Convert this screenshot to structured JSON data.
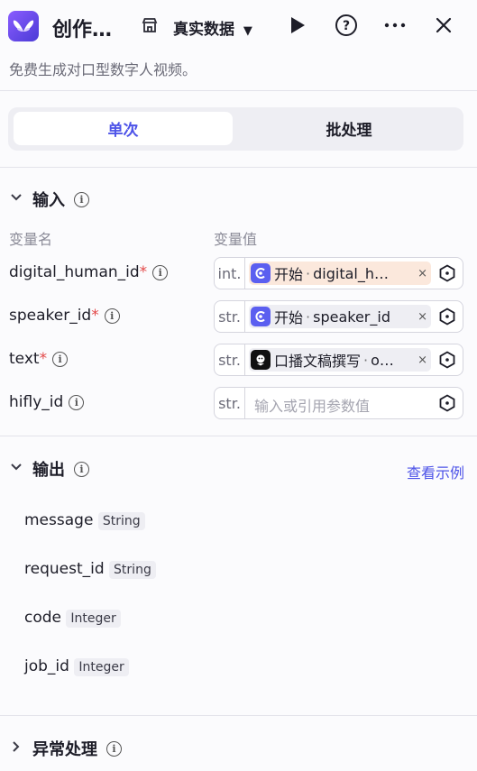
{
  "header": {
    "title": "创作…",
    "data_source": "真实数据",
    "logo_icon": "butterfly-logo",
    "accent": "#4d53e8"
  },
  "subtitle": "免费生成对口型数字人视频。",
  "tabs": [
    {
      "label": "单次",
      "active": true
    },
    {
      "label": "批处理",
      "active": false
    }
  ],
  "input_section": {
    "title": "输入",
    "col_name": "变量名",
    "col_value": "变量值",
    "rows": [
      {
        "name": "digital_human_id",
        "required": "*",
        "type": "int.",
        "source": "开始",
        "ref": "digital_h…",
        "sep": "·",
        "remove": "×"
      },
      {
        "name": "speaker_id",
        "required": "*",
        "type": "str.",
        "source": "开始",
        "ref": "speaker_id",
        "sep": "·",
        "remove": "×"
      },
      {
        "name": "text",
        "required": "*",
        "type": "str.",
        "source": "口播文稿撰写",
        "ref": "o…",
        "sep": "·",
        "remove": "×"
      },
      {
        "name": "hifly_id",
        "required": "",
        "type": "str.",
        "placeholder": "输入或引用参数值"
      }
    ]
  },
  "output_section": {
    "title": "输出",
    "example_link": "查看示例",
    "fields": [
      {
        "name": "message",
        "type": "String"
      },
      {
        "name": "request_id",
        "type": "String"
      },
      {
        "name": "code",
        "type": "Integer"
      },
      {
        "name": "job_id",
        "type": "Integer"
      }
    ]
  },
  "exception_section": {
    "title": "异常处理"
  }
}
